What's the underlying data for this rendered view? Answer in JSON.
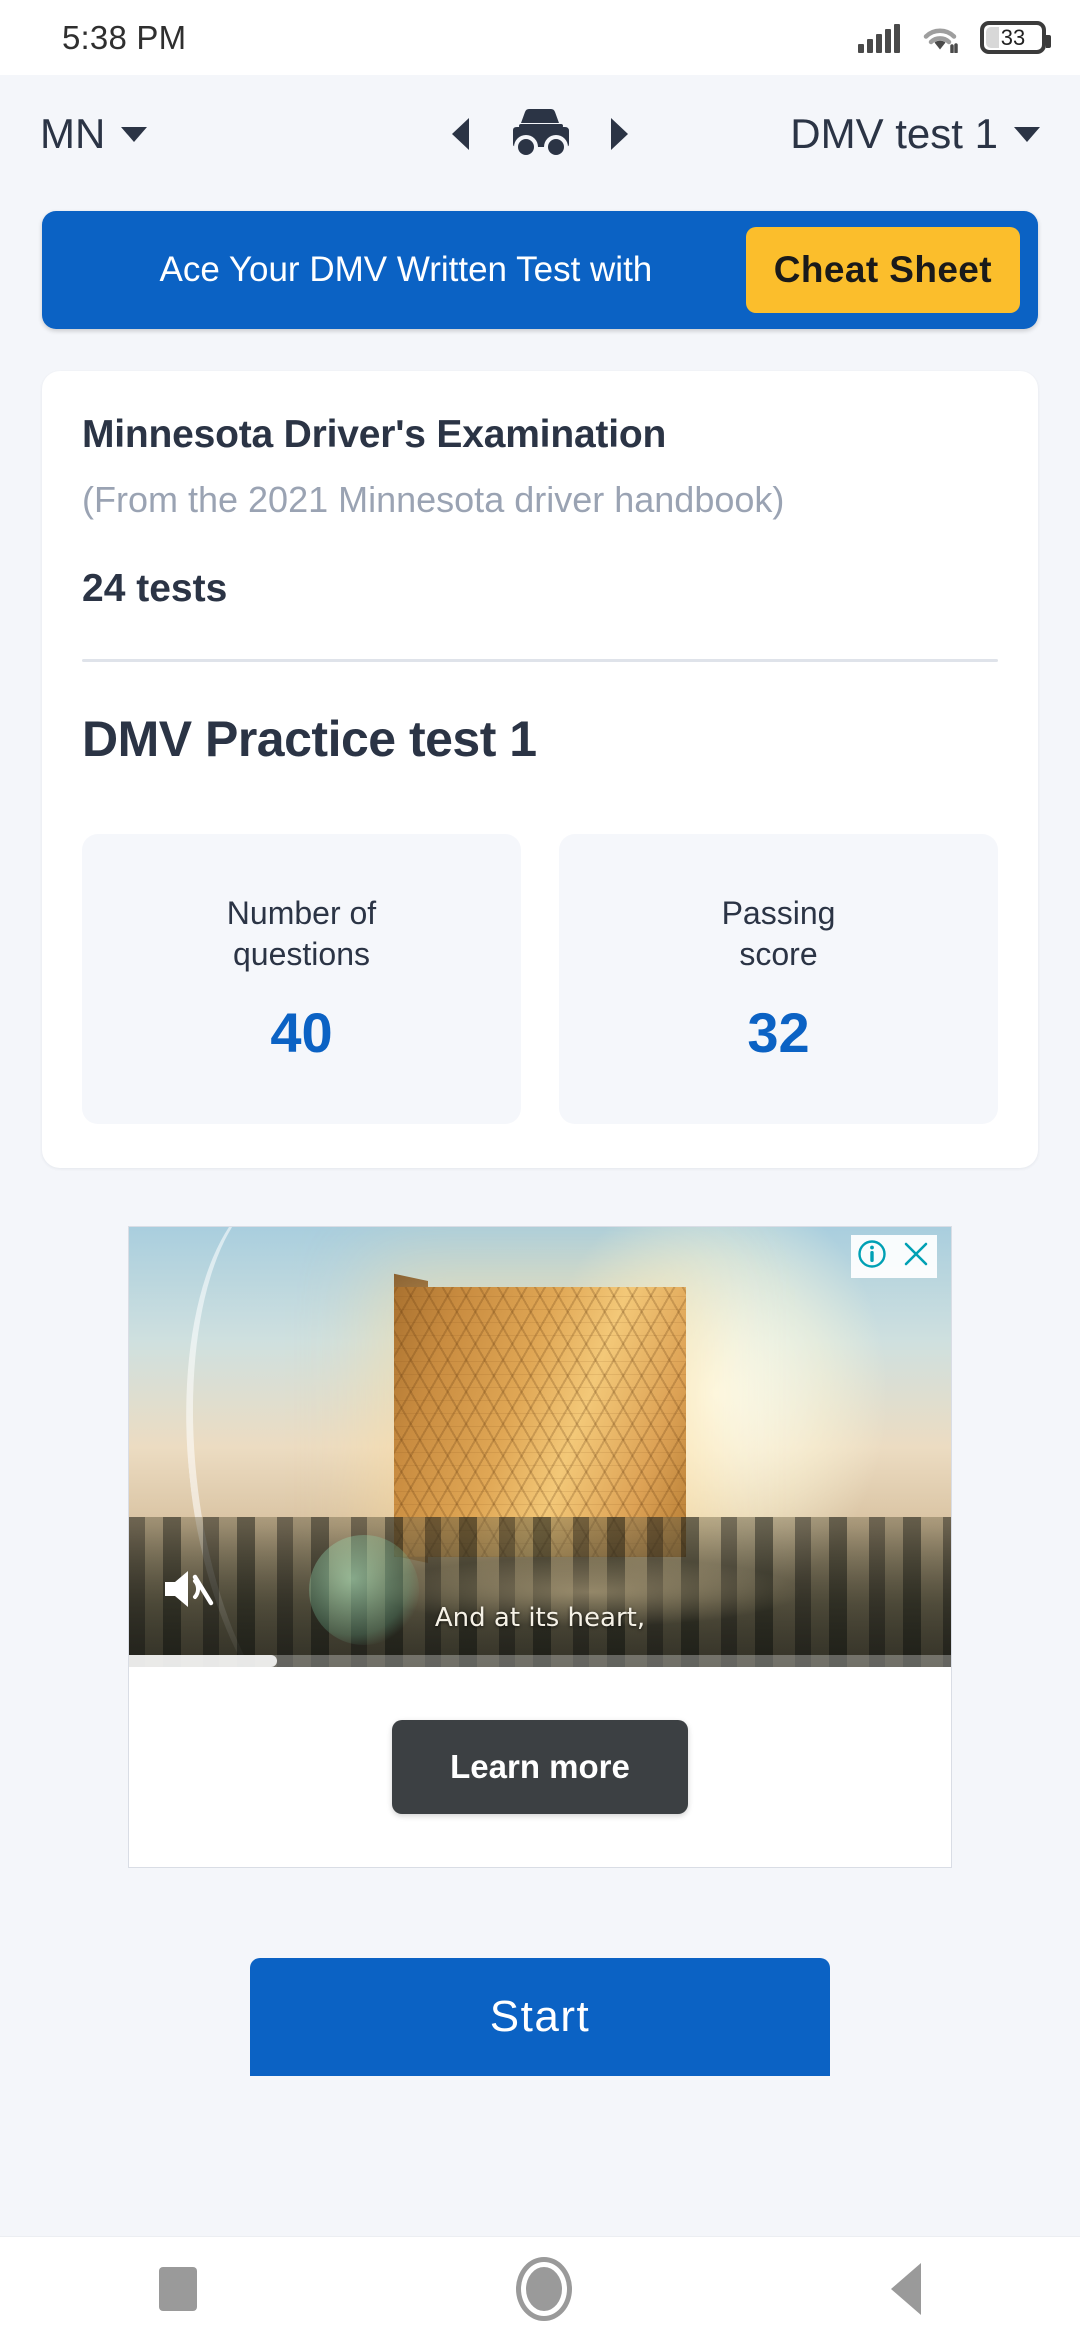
{
  "status_bar": {
    "time": "5:38 PM",
    "battery_level": "33",
    "signal_icon": "cellular-signal-icon",
    "wifi_icon": "wifi-icon",
    "battery_icon": "battery-icon"
  },
  "header": {
    "state": "MN",
    "test_name": "DMV test 1",
    "vehicle_icon": "car-icon",
    "prev_icon": "arrow-left-icon",
    "next_icon": "arrow-right-icon",
    "state_caret_icon": "chevron-down-icon",
    "test_caret_icon": "chevron-down-icon"
  },
  "promo": {
    "text": "Ace Your DMV Written Test with",
    "button_label": "Cheat Sheet",
    "background_color": "#0b62c4",
    "button_color": "#fbbe2c"
  },
  "card": {
    "title": "Minnesota Driver's Examination",
    "subtitle": "(From the 2021 Minnesota driver handbook)",
    "tests_count": "24 tests",
    "practice_title": "DMV Practice test 1",
    "stats": [
      {
        "label": "Number of\nquestions",
        "label_line1": "Number of",
        "label_line2": "questions",
        "value": "40"
      },
      {
        "label": "Passing\nscore",
        "label_line1": "Passing",
        "label_line2": "score",
        "value": "32"
      }
    ],
    "accent_color": "#0b62c4"
  },
  "ad": {
    "info_icon": "ad-info-icon",
    "close_icon": "ad-close-icon",
    "mute_icon": "volume-muted-icon",
    "caption": "And at its heart,",
    "cta_label": "Learn more",
    "cta_color": "#3c4043",
    "progress_percent": "18"
  },
  "start": {
    "label": "Start",
    "color": "#0b62c4"
  },
  "nav_bar": {
    "recents_icon": "recents-square-icon",
    "home_icon": "home-circle-icon",
    "back_icon": "back-triangle-icon"
  }
}
